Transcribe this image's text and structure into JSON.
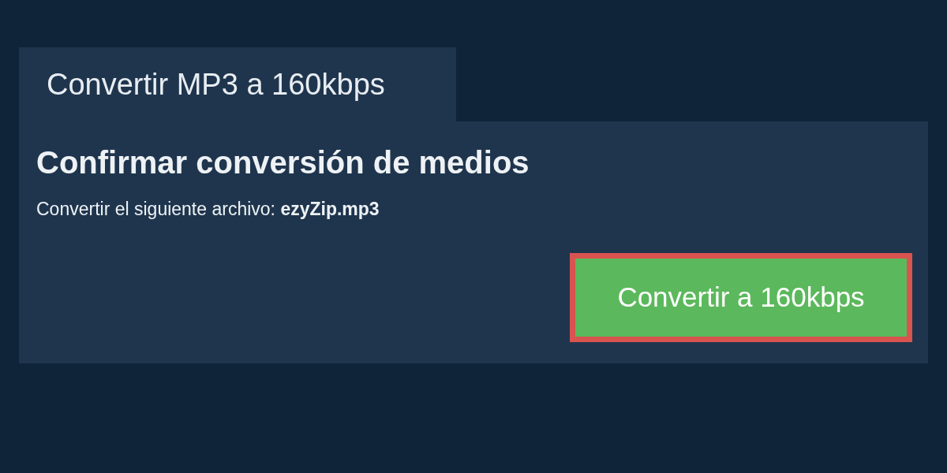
{
  "tab": {
    "label": "Convertir MP3 a 160kbps"
  },
  "panel": {
    "title": "Confirmar conversión de medios",
    "message": "Convertir el siguiente archivo: **ezyZip.mp3**",
    "button": {
      "label": "Convertir a 160kbps",
      "highlighted": true
    }
  }
}
